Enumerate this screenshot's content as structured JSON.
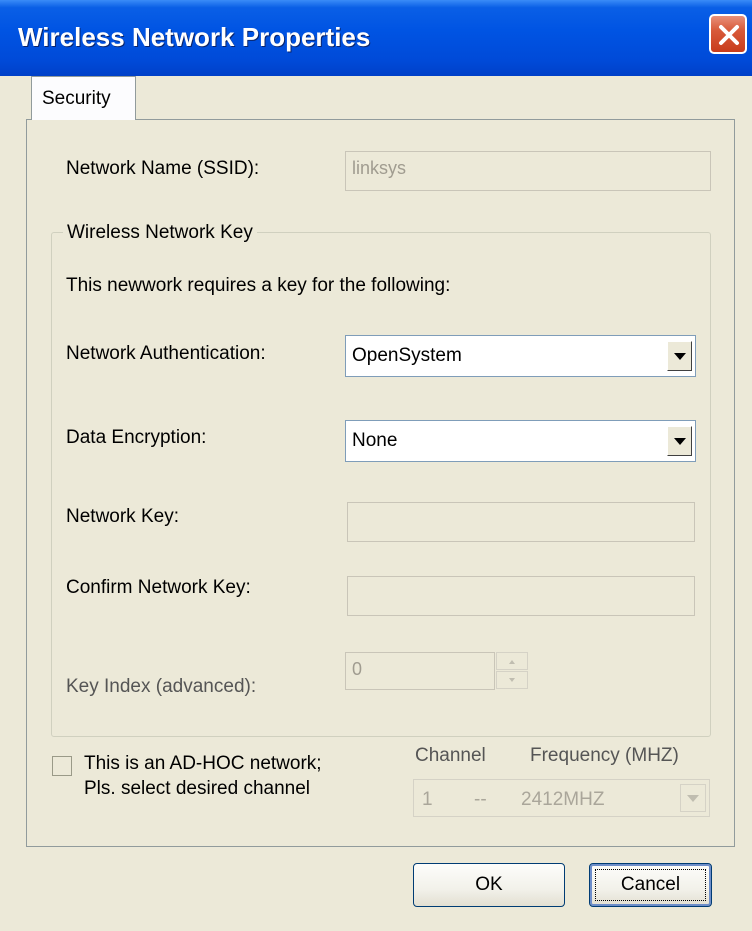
{
  "window": {
    "title": "Wireless Network Properties"
  },
  "tabs": [
    {
      "label": "Security"
    }
  ],
  "ssid": {
    "label": "Network Name (SSID):",
    "value": "linksys"
  },
  "key_group": {
    "legend": "Wireless Network Key",
    "intro": "This newwork requires a key for the following:",
    "auth": {
      "label": "Network Authentication:",
      "value": "OpenSystem"
    },
    "encryption": {
      "label": "Data Encryption:",
      "value": "None"
    },
    "network_key": {
      "label": "Network Key:",
      "value": ""
    },
    "confirm_key": {
      "label": "Confirm Network Key:",
      "value": ""
    },
    "key_index": {
      "label": "Key Index (advanced):",
      "value": "0"
    }
  },
  "adhoc": {
    "line1": "This is an AD-HOC network;",
    "line2": "Pls. select desired channel",
    "channel_header": "Channel",
    "frequency_header": "Frequency (MHZ)",
    "channel_value": "1",
    "separator": "--",
    "frequency_value": "2412MHZ"
  },
  "buttons": {
    "ok": "OK",
    "cancel": "Cancel"
  }
}
